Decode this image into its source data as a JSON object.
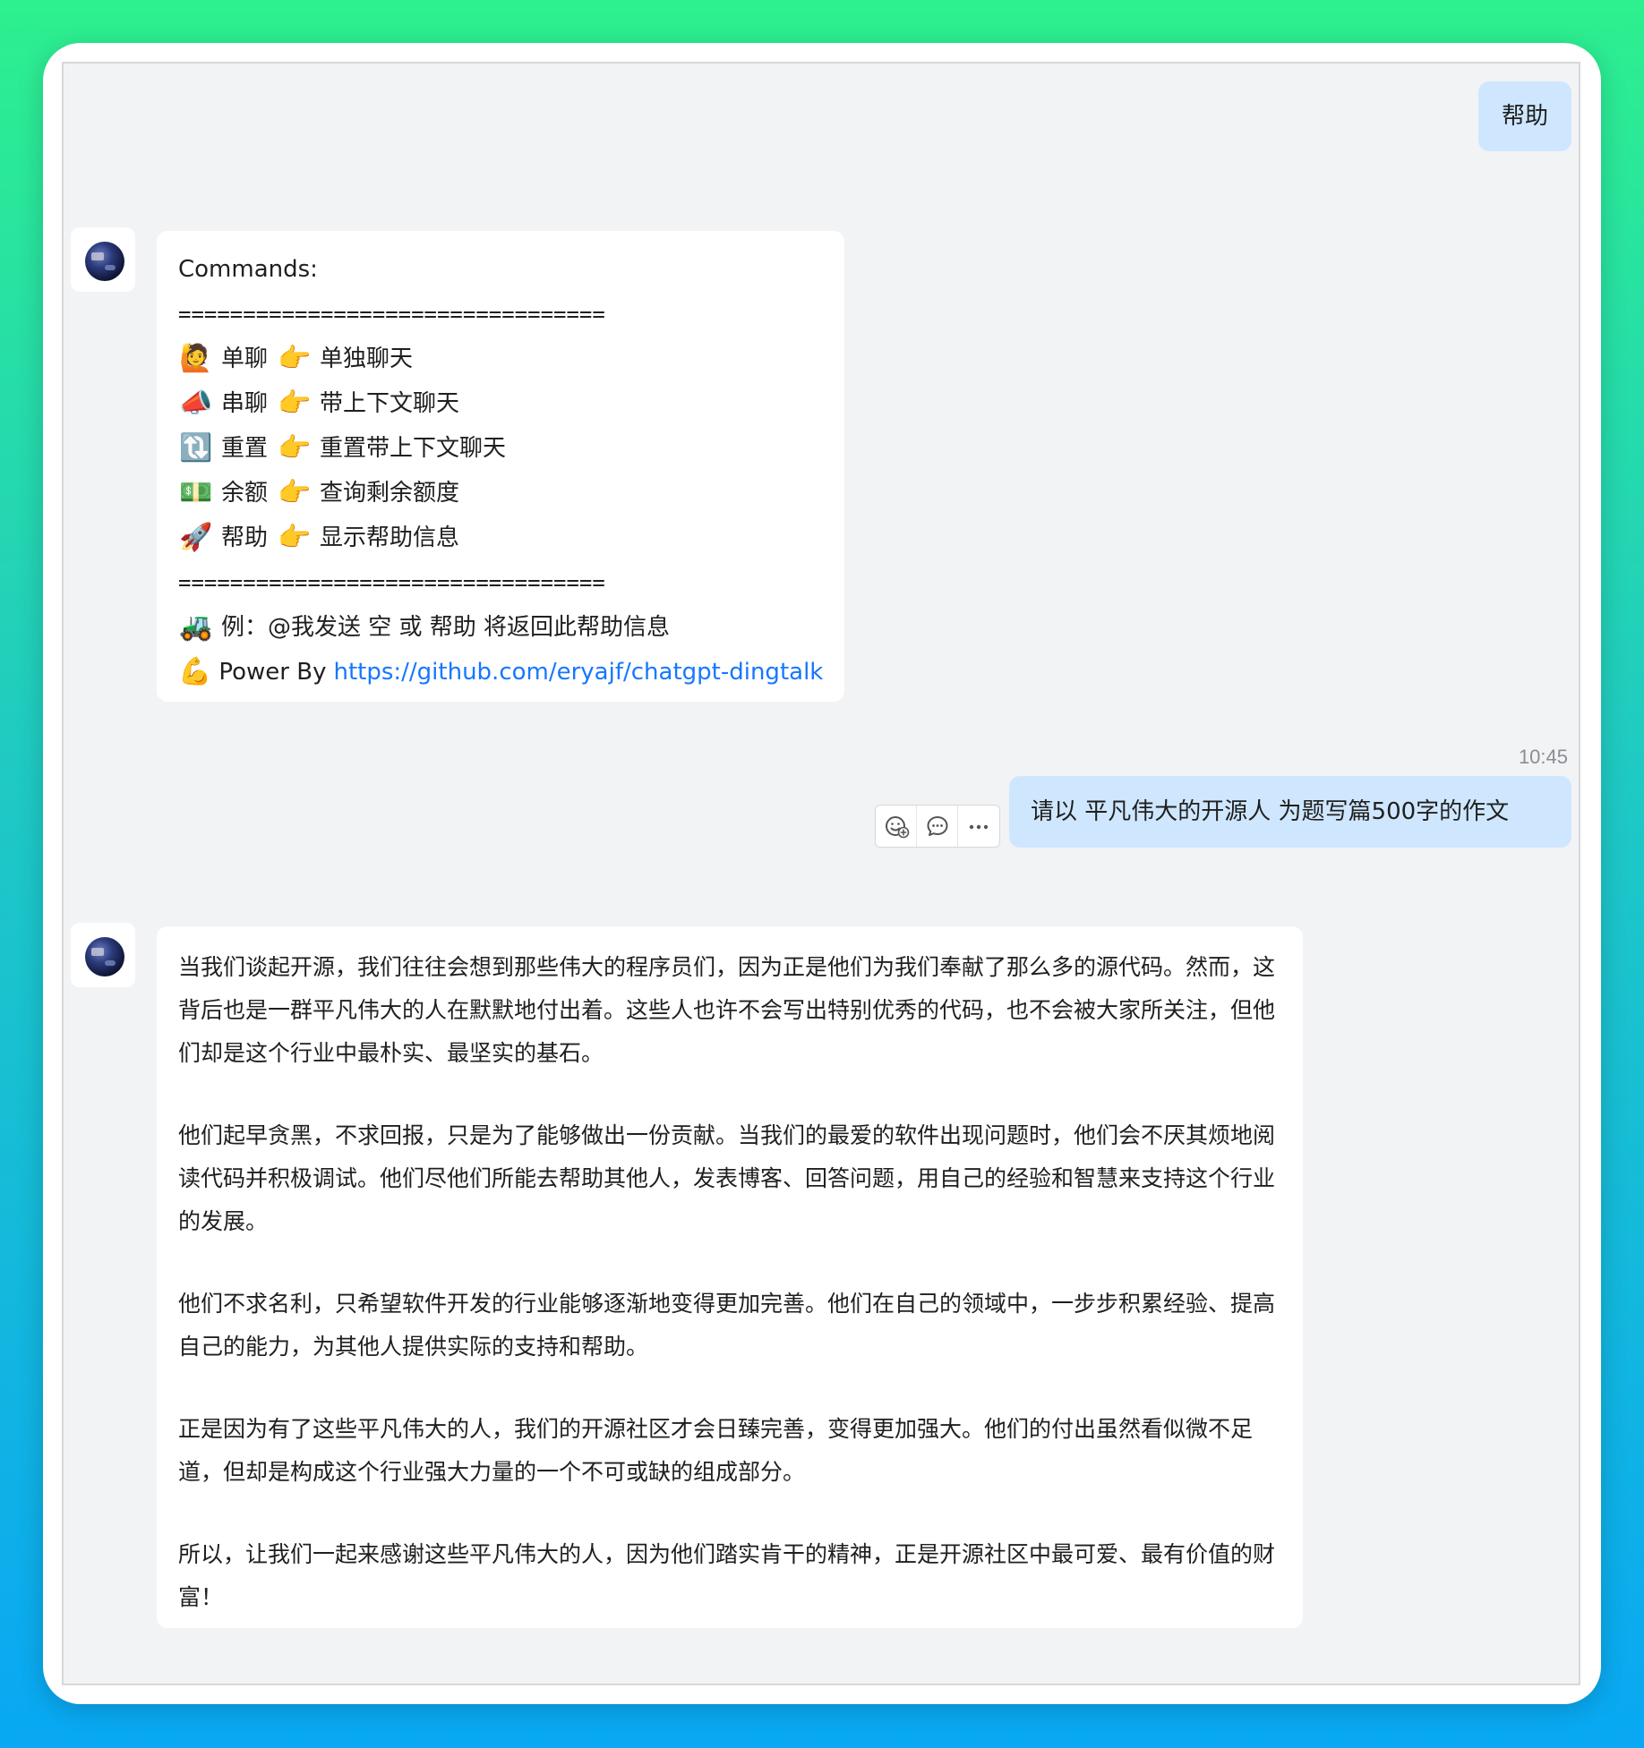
{
  "messages": {
    "user1": {
      "text": "帮助"
    },
    "bot1": {
      "heading": "Commands:",
      "separator": "=================================",
      "commands": [
        {
          "emoji": "🙋",
          "name": "单聊",
          "pointer": "👉",
          "desc": "单独聊天"
        },
        {
          "emoji": "📣",
          "name": "串聊",
          "pointer": "👉",
          "desc": "带上下文聊天"
        },
        {
          "emoji": "🔃",
          "name": "重置",
          "pointer": "👉",
          "desc": "重置带上下文聊天"
        },
        {
          "emoji": "💵",
          "name": "余额",
          "pointer": "👉",
          "desc": "查询剩余额度"
        },
        {
          "emoji": "🚀",
          "name": "帮助",
          "pointer": "👉",
          "desc": "显示帮助信息"
        }
      ],
      "example_emoji": "🚜",
      "example_text": "例：@我发送 空 或 帮助 将返回此帮助信息",
      "power_emoji": "💪",
      "power_label": "Power By",
      "power_link": "https://github.com/eryajf/chatgpt-dingtalk"
    },
    "user2": {
      "time": "10:45",
      "text": "请以 平凡伟大的开源人 为题写篇500字的作文"
    },
    "bot2": {
      "paragraphs": [
        "当我们谈起开源，我们往往会想到那些伟大的程序员们，因为正是他们为我们奉献了那么多的源代码。然而，这背后也是一群平凡伟大的人在默默地付出着。这些人也许不会写出特别优秀的代码，也不会被大家所关注，但他们却是这个行业中最朴实、最坚实的基石。",
        "他们起早贪黑，不求回报，只是为了能够做出一份贡献。当我们的最爱的软件出现问题时，他们会不厌其烦地阅读代码并积极调试。他们尽他们所能去帮助其他人，发表博客、回答问题，用自己的经验和智慧来支持这个行业的发展。",
        "他们不求名利，只希望软件开发的行业能够逐渐地变得更加完善。他们在自己的领域中，一步步积累经验、提高自己的能力，为其他人提供实际的支持和帮助。",
        "正是因为有了这些平凡伟大的人，我们的开源社区才会日臻完善，变得更加强大。他们的付出虽然看似微不足道，但却是构成这个行业强大力量的一个不可或缺的组成部分。",
        "所以，让我们一起来感谢这些平凡伟大的人，因为他们踏实肯干的精神，正是开源社区中最可爱、最有价值的财富！"
      ]
    }
  },
  "actions": {
    "icons": [
      "emoji-reaction-icon",
      "reply-icon",
      "more-icon"
    ]
  },
  "colors": {
    "out_bubble": "#cfe7fe",
    "in_bubble": "#ffffff",
    "chat_bg": "#f2f3f5",
    "link": "#1677ff"
  }
}
